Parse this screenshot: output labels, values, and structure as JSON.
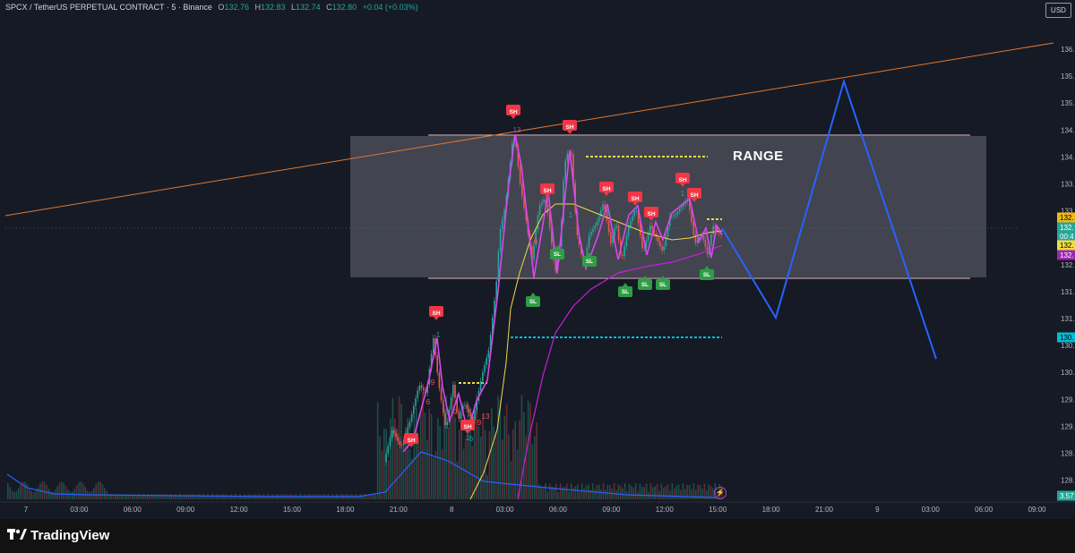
{
  "header": {
    "symbol": "SPCX / TetherUS PERPETUAL CONTRACT · 5 · Binance",
    "open_label": "O",
    "open": "132.76",
    "high_label": "H",
    "high": "132.83",
    "low_label": "L",
    "low": "132.74",
    "close_label": "C",
    "close": "132.80",
    "change": "+0.04 (+0.03%)"
  },
  "currency_button": "USD",
  "brand": "TradingView",
  "annotation_range": "RANGE",
  "bolt_glyph": "⚡",
  "chart_data": {
    "type": "line",
    "x_ticks": [
      "7",
      "03:00",
      "06:00",
      "09:00",
      "12:00",
      "15:00",
      "18:00",
      "21:00",
      "8",
      "03:00",
      "06:00",
      "09:00",
      "12:00",
      "15:00",
      "18:00",
      "21:00",
      "9",
      "03:00",
      "06:00",
      "09:00"
    ],
    "y_ticks": [
      "136.",
      "135.",
      "135.",
      "134.",
      "134.",
      "133.",
      "133.",
      "132.",
      "132.",
      "131.",
      "131.",
      "130.",
      "130.",
      "129.",
      "129.",
      "128.",
      "128."
    ],
    "price_badges": [
      {
        "text": "132.",
        "color": "#f0b90b",
        "text_color": "#000000"
      },
      {
        "text": "132.",
        "color": "#26a69a",
        "text_color": "#ffffff"
      },
      {
        "text": "00:4",
        "color": "#26a69a",
        "text_color": "#ffffff"
      },
      {
        "text": "132.",
        "color": "#f0d943",
        "text_color": "#000000"
      },
      {
        "text": "132.",
        "color": "#9c27b0",
        "text_color": "#ffffff"
      },
      {
        "text": "130.",
        "color": "#00bcd4",
        "text_color": "#000000"
      },
      {
        "text": "3.57",
        "color": "#26a69a",
        "text_color": "#ffffff"
      }
    ],
    "markers": [
      {
        "label": "SH",
        "kind": "high"
      },
      {
        "label": "SH",
        "kind": "high"
      },
      {
        "label": "SH",
        "kind": "high"
      },
      {
        "label": "SH",
        "kind": "high"
      },
      {
        "label": "SH",
        "kind": "high"
      },
      {
        "label": "SH",
        "kind": "high"
      },
      {
        "label": "SH",
        "kind": "high"
      },
      {
        "label": "SH",
        "kind": "high"
      },
      {
        "label": "SH",
        "kind": "high"
      },
      {
        "label": "SH",
        "kind": "high"
      },
      {
        "label": "SH",
        "kind": "high"
      },
      {
        "label": "SL",
        "kind": "low"
      },
      {
        "label": "SL",
        "kind": "low"
      },
      {
        "label": "SL",
        "kind": "low"
      },
      {
        "label": "SL",
        "kind": "low"
      },
      {
        "label": "SL",
        "kind": "low"
      },
      {
        "label": "SL",
        "kind": "low"
      },
      {
        "label": "SL",
        "kind": "low"
      }
    ],
    "count_labels": [
      "1",
      "9",
      "6",
      "9",
      "13",
      "6",
      "9",
      "1",
      "13",
      "6",
      "1",
      "1",
      "6",
      "1",
      "1",
      "8"
    ]
  }
}
